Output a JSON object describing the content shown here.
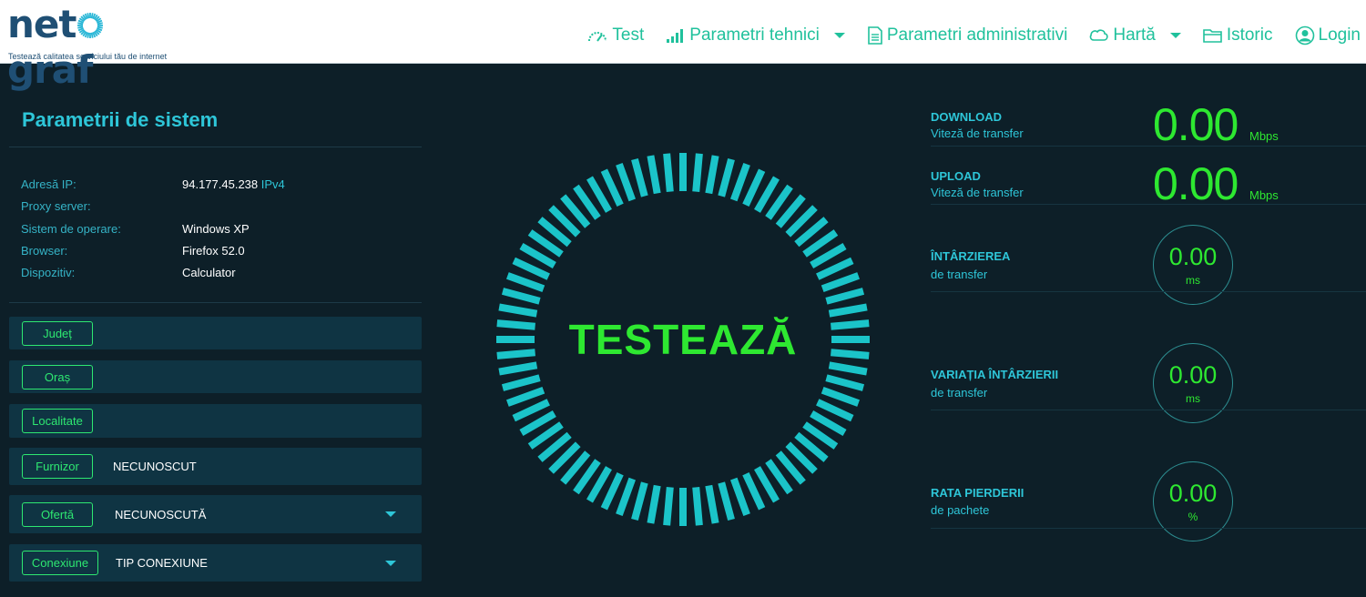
{
  "header": {
    "logo": "netograf",
    "tagline": "Testează calitatea serviciului tău de internet",
    "nav": {
      "test": "Test",
      "tech": "Parametri tehnici",
      "admin": "Parametri administrativi",
      "map": "Hartă",
      "history": "Istoric",
      "login": "Login"
    }
  },
  "system": {
    "title": "Parametrii de sistem",
    "rows": [
      {
        "label": "Adresă IP:",
        "value": "94.177.45.238",
        "suffix": "IPv4"
      },
      {
        "label": "Proxy server:",
        "value": ""
      },
      {
        "label": "Sistem de operare:",
        "value": "Windows XP"
      },
      {
        "label": "Browser:",
        "value": "Firefox 52.0"
      },
      {
        "label": "Dispozitiv:",
        "value": "Calculator"
      }
    ]
  },
  "fields": [
    {
      "tag": "Județ",
      "value": ""
    },
    {
      "tag": "Oraș",
      "value": ""
    },
    {
      "tag": "Localitate",
      "value": ""
    },
    {
      "tag": "Furnizor",
      "value": "NECUNOSCUT"
    },
    {
      "tag": "Ofertă",
      "value": "NECUNOSCUTĂ"
    },
    {
      "tag": "Conexiune",
      "value": "TIP CONEXIUNE"
    }
  ],
  "gauge": {
    "label": "TESTEAZĂ",
    "color": "#1bc4c9"
  },
  "metrics": {
    "download": {
      "title": "DOWNLOAD",
      "sub": "Viteză de transfer",
      "value": "0.00",
      "unit": "Mbps"
    },
    "upload": {
      "title": "UPLOAD",
      "sub": "Viteză de transfer",
      "value": "0.00",
      "unit": "Mbps"
    },
    "latency": {
      "title": "ÎNTÂRZIEREA",
      "sub": "de transfer",
      "value": "0.00",
      "unit": "ms"
    },
    "jitter": {
      "title": "VARIAȚIA ÎNTÂRZIERII",
      "sub": "de transfer",
      "value": "0.00",
      "unit": "ms"
    },
    "loss": {
      "title": "RATA PIERDERII",
      "sub": "de pachete",
      "value": "0.00",
      "unit": "%"
    }
  },
  "colors": {
    "accent": "#20c19c",
    "green": "#2ee831",
    "cyan": "#2ec6d8",
    "background": "#0d1f28"
  }
}
